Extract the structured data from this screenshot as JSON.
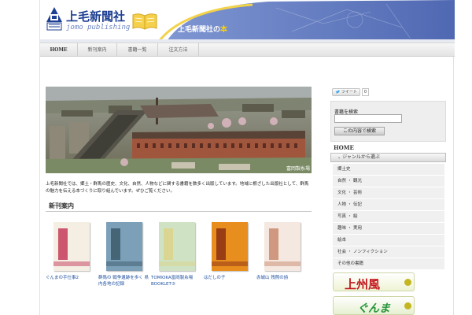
{
  "header": {
    "logo_text": "上毛新聞社",
    "logo_sub": "jomo publishing",
    "tagline_prefix": "上毛新聞社の",
    "tagline_accent": "本"
  },
  "nav": {
    "items": [
      {
        "label": "HOME"
      },
      {
        "label": "新刊案内"
      },
      {
        "label": "書籍一覧"
      },
      {
        "label": "注文方法"
      }
    ]
  },
  "hero": {
    "caption": "富岡製糸場"
  },
  "intro": {
    "text": "上毛新聞社では、郷土・群馬の歴史、文化、自然、人物などに関する書籍を数多く出版しています。地域に根ざした出版社として、群馬の魅力を伝える本づくりに取り組んでいます。ぜひご覧ください。"
  },
  "section": {
    "title": "新刊案内"
  },
  "books": [
    {
      "title": "ぐんまの手仕事2",
      "cover_bg": "#f4efe2",
      "accent": "#c33b59"
    },
    {
      "title": "群馬の 戦争遺跡を歩く 県内各地の記録",
      "cover_bg": "#7ca0b8",
      "accent": "#3c5a6b"
    },
    {
      "title": "TOMIOKA富岡製糸場 BOOKLET③",
      "cover_bg": "#cfe2c4",
      "accent": "#dcd48a"
    },
    {
      "title": "はだしの子",
      "cover_bg": "#e88e1f",
      "accent": "#8a2f13"
    },
    {
      "title": "赤城山 残照の詩",
      "cover_bg": "#f5e8e0",
      "accent": "#c98a6f"
    }
  ],
  "sidebar": {
    "tweet_label": "ツイート",
    "tweet_count": "0",
    "search_label": "書籍を検索",
    "search_value": "",
    "search_button": "この内容で検索",
    "home_label": "HOME",
    "genre_heading": "ジャンルから選ぶ",
    "genres": [
      "郷土史",
      "自然 ・ 観光",
      "文化 ・ 芸術",
      "人物 ・ 伝記",
      "写真 ・ 絵",
      "趣味 ・ 実用",
      "絵本",
      "社会 ・ ノンフィクション",
      "その他の書籍"
    ],
    "banner1_text": "上州風",
    "banner2_text": "ぐんま"
  },
  "colors": {
    "brand_blue": "#1e3f93",
    "header_blue": "#5b76be",
    "link_blue": "#1f4fa0"
  }
}
